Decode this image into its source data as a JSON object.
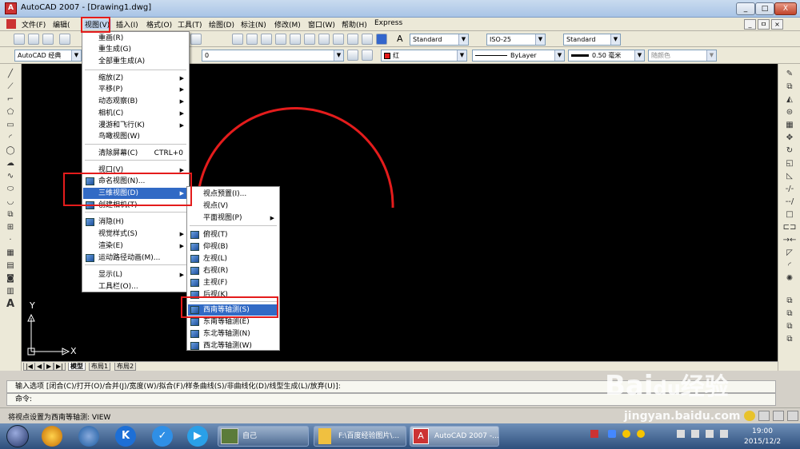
{
  "window": {
    "title": "AutoCAD 2007 - [Drawing1.dwg]",
    "app_icon": "autocad-icon",
    "min": "_",
    "restore": "□",
    "close": "X",
    "doc_min": "_",
    "doc_restore": "ㅁ",
    "doc_close": "×"
  },
  "menubar": [
    "文件(F)",
    "编辑(",
    "视图(V)",
    "插入(I)",
    "格式(O)",
    "工具(T)",
    "绘图(D)",
    "标注(N)",
    "修改(M)",
    "窗口(W)",
    "帮助(H)",
    "Express"
  ],
  "toolbar": {
    "textstyle": "Standard",
    "dimstyle": "ISO-25",
    "tablestyle": "Standard",
    "workspace": "AutoCAD 经典",
    "layer": "0",
    "color": "红",
    "linetype": "ByLayer",
    "lineweight": "0.50 毫米",
    "plotstyle": "随颜色"
  },
  "view_menu": {
    "items": [
      {
        "label": "重画(R)",
        "name": "redraw"
      },
      {
        "label": "重生成(G)",
        "name": "regen"
      },
      {
        "label": "全部重生成(A)",
        "name": "regen-all"
      },
      {
        "label": "缩放(Z)",
        "name": "zoom",
        "sub": true
      },
      {
        "label": "平移(P)",
        "name": "pan",
        "sub": true
      },
      {
        "label": "动态观察(B)",
        "name": "orbit",
        "sub": true
      },
      {
        "label": "相机(C)",
        "name": "camera",
        "sub": true
      },
      {
        "label": "漫游和飞行(K)",
        "name": "walk-fly",
        "sub": true
      },
      {
        "label": "鸟瞰视图(W)",
        "name": "aerial-view"
      },
      {
        "label": "清除屏幕(C)",
        "name": "clean-screen",
        "shortcut": "CTRL+0"
      },
      {
        "label": "视口(V)",
        "name": "viewports",
        "sub": true
      },
      {
        "label": "命名视图(N)...",
        "name": "named-views"
      },
      {
        "label": "三维视图(D)",
        "name": "3d-views",
        "sub": true,
        "highlight": true
      },
      {
        "label": "创建相机(T)",
        "name": "create-camera"
      },
      {
        "label": "消隐(H)",
        "name": "hide"
      },
      {
        "label": "视觉样式(S)",
        "name": "visual-styles",
        "sub": true
      },
      {
        "label": "渲染(E)",
        "name": "render",
        "sub": true
      },
      {
        "label": "运动路径动画(M)...",
        "name": "motion-path"
      },
      {
        "label": "显示(L)",
        "name": "display",
        "sub": true
      },
      {
        "label": "工具栏(O)...",
        "name": "toolbars"
      }
    ]
  },
  "sub_menu": {
    "items": [
      {
        "label": "视点预置(I)...",
        "name": "viewpoint-presets"
      },
      {
        "label": "视点(V)",
        "name": "viewpoint"
      },
      {
        "label": "平面视图(P)",
        "name": "plan-view",
        "sub": true
      },
      {
        "label": "俯视(T)",
        "name": "top"
      },
      {
        "label": "仰视(B)",
        "name": "bottom"
      },
      {
        "label": "左视(L)",
        "name": "left"
      },
      {
        "label": "右视(R)",
        "name": "right"
      },
      {
        "label": "主视(F)",
        "name": "front"
      },
      {
        "label": "后视(K)",
        "name": "back"
      },
      {
        "label": "西南等轴测(S)",
        "name": "sw-iso",
        "highlight": true
      },
      {
        "label": "东南等轴测(E)",
        "name": "se-iso"
      },
      {
        "label": "东北等轴测(N)",
        "name": "ne-iso"
      },
      {
        "label": "西北等轴测(W)",
        "name": "nw-iso"
      }
    ]
  },
  "ucs": {
    "x": "X",
    "y": "Y"
  },
  "layout_tabs": {
    "nav": [
      "|◀",
      "◀",
      "▶",
      "▶|"
    ],
    "tabs": [
      "模型",
      "布局1",
      "布局2"
    ]
  },
  "command": {
    "line1": "输入选项 [闭合(C)/打开(O)/合并(J)/宽度(W)/拟合(F)/样条曲线(S)/非曲线化(D)/线型生成(L)/放弃(U)]:",
    "line2": "命令:"
  },
  "status": {
    "text": "将视点设置为西南等轴测:   VIEW"
  },
  "taskbar": {
    "apps": [
      "ie-like-icon",
      "browser-icon",
      "k-icon",
      "shield-icon",
      "video-icon"
    ],
    "tasks": [
      "自己",
      "F:\\百度经验图片\\...",
      "AutoCAD 2007 -..."
    ],
    "time": "19:00",
    "date": "2015/12/2"
  },
  "watermark": {
    "brand": "Bai",
    "paw": "du",
    "cn": "经验",
    "url": "jingyan.baidu.com"
  },
  "colors": {
    "accent": "#316ac5",
    "annotation": "#e41c1c",
    "arc": "#e41c1c",
    "canvas": "#000000"
  }
}
